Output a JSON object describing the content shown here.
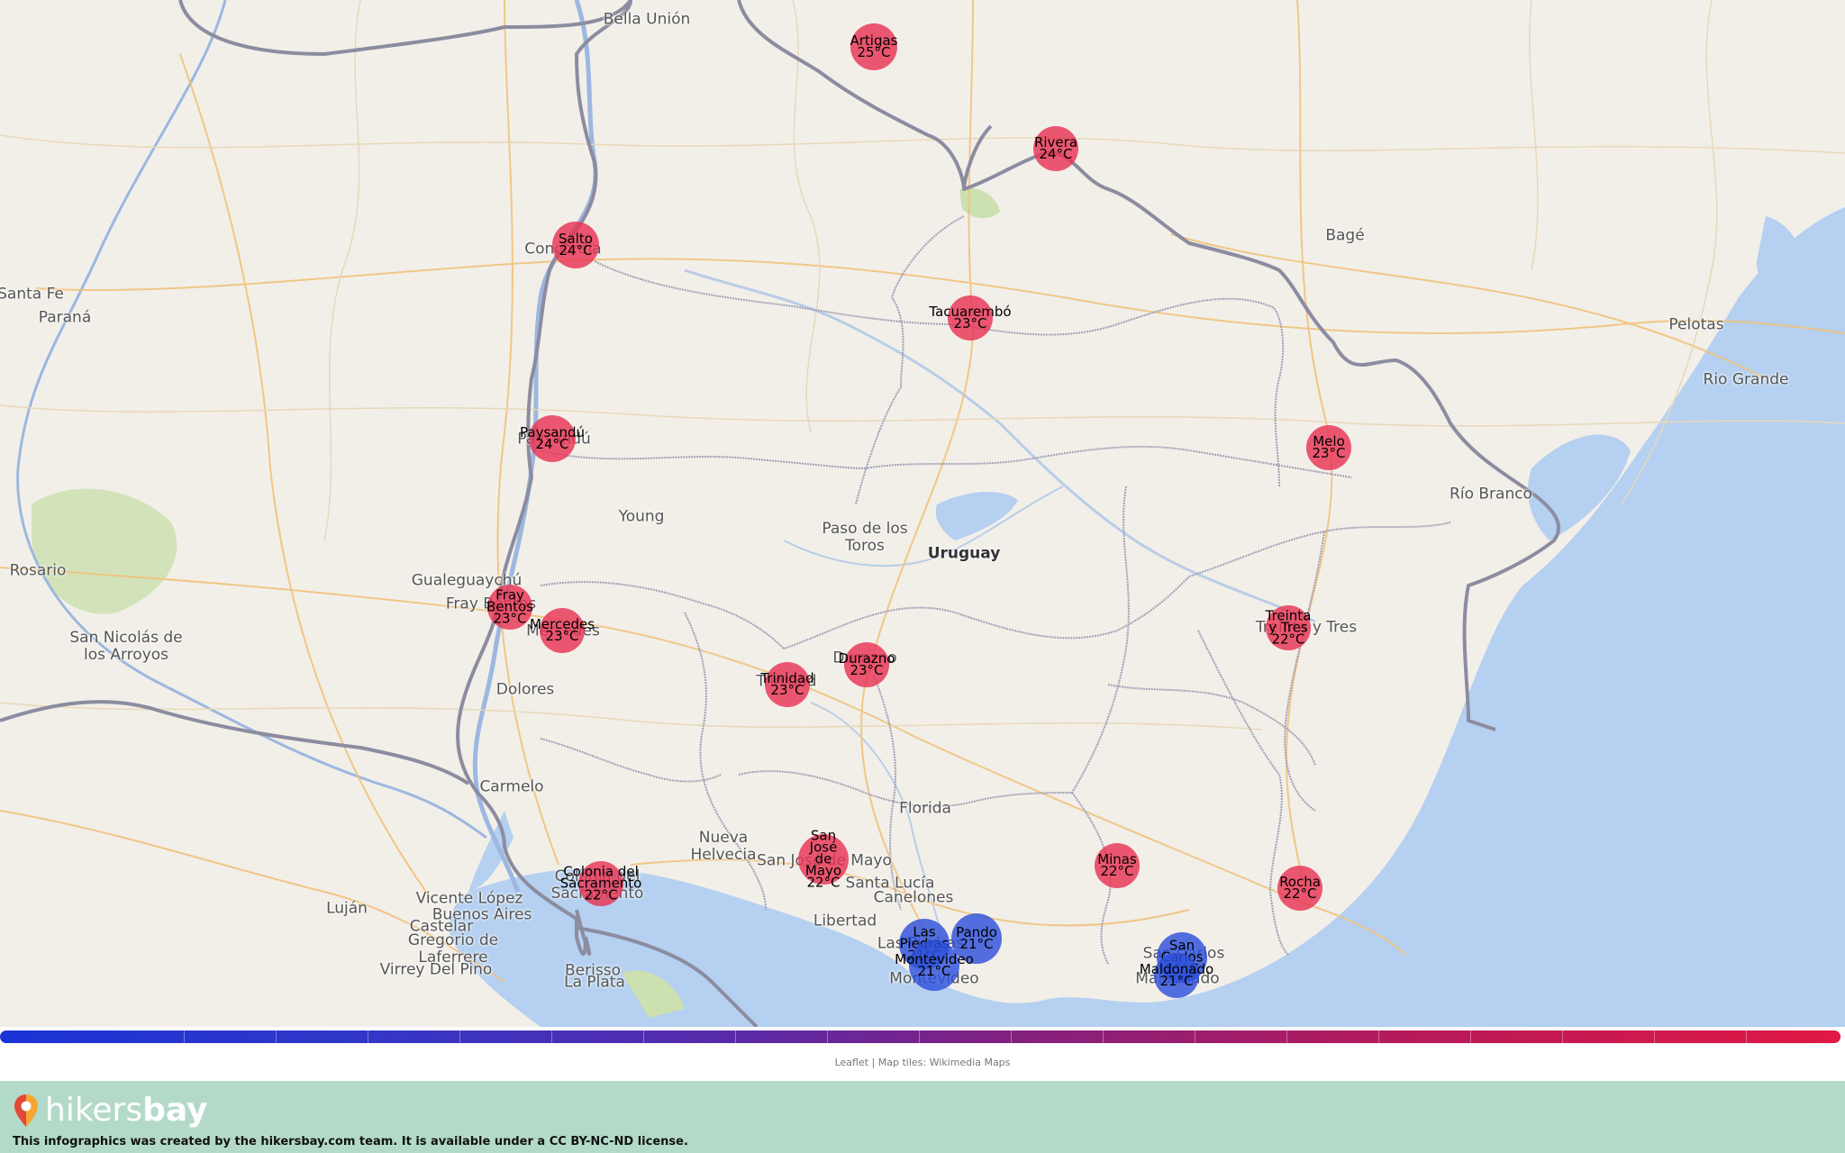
{
  "places": [
    {
      "name": "Bella Unión"
    },
    {
      "name": "Santa Fe"
    },
    {
      "name": "Paraná"
    },
    {
      "name": "Concordia"
    },
    {
      "name": "Paysandú"
    },
    {
      "name": "Young"
    },
    {
      "name": "Gualeguaychú"
    },
    {
      "name": "Fray Bentos"
    },
    {
      "name": "Mercedes"
    },
    {
      "name": "Rosario"
    },
    {
      "name": "San Nicolás de\nlos Arroyos"
    },
    {
      "name": "Dolores"
    },
    {
      "name": "Carmelo"
    },
    {
      "name": "Nueva\nHelvecia"
    },
    {
      "name": "Colonia del\nSacramento"
    },
    {
      "name": "Vicente López"
    },
    {
      "name": "Buenos Aires"
    },
    {
      "name": "Castelar"
    },
    {
      "name": "Gregorio de\nLaferrere"
    },
    {
      "name": "Virrey Del Pino"
    },
    {
      "name": "Luján"
    },
    {
      "name": "Berisso"
    },
    {
      "name": "La Plata"
    },
    {
      "name": "Paso de los\nToros"
    },
    {
      "name": "Uruguay",
      "country": true
    },
    {
      "name": "Florida"
    },
    {
      "name": "Santa Lucía"
    },
    {
      "name": "Canelones"
    },
    {
      "name": "Libertad"
    },
    {
      "name": "Las Piedras"
    },
    {
      "name": "Montevideo"
    },
    {
      "name": "San Carlos"
    },
    {
      "name": "Maldonado"
    },
    {
      "name": "Bagé"
    },
    {
      "name": "Pelotas"
    },
    {
      "name": "Rio Grande"
    },
    {
      "name": "Río Branco"
    },
    {
      "name": "Treinta y Tres"
    },
    {
      "name": "Trinidad"
    },
    {
      "name": "Durazno"
    },
    {
      "name": "San José de Mayo"
    }
  ],
  "cities": [
    {
      "name": "Artigas",
      "temp": "25°C",
      "kind": "warm"
    },
    {
      "name": "Rivera",
      "temp": "24°C",
      "kind": "warm"
    },
    {
      "name": "Salto",
      "temp": "24°C",
      "kind": "warm"
    },
    {
      "name": "Tacuarembó",
      "temp": "23°C",
      "kind": "warm"
    },
    {
      "name": "Paysandú",
      "temp": "24°C",
      "kind": "warm"
    },
    {
      "name": "Melo",
      "temp": "23°C",
      "kind": "warm"
    },
    {
      "name": "Fray\nBentos",
      "temp": "23°C",
      "kind": "warm"
    },
    {
      "name": "Mercedes",
      "temp": "23°C",
      "kind": "warm"
    },
    {
      "name": "Treinta\ny Tres",
      "temp": "22°C",
      "kind": "warm"
    },
    {
      "name": "Durazno",
      "temp": "23°C",
      "kind": "warm"
    },
    {
      "name": "Trinidad",
      "temp": "23°C",
      "kind": "warm"
    },
    {
      "name": "San\nJosé\nde\nMayo",
      "temp": "22°C",
      "kind": "warm"
    },
    {
      "name": "Colonia del\nSacramento",
      "temp": "22°C",
      "kind": "warm"
    },
    {
      "name": "Minas",
      "temp": "22°C",
      "kind": "warm"
    },
    {
      "name": "Rocha",
      "temp": "22°C",
      "kind": "warm"
    },
    {
      "name": "Las\nPiedras",
      "temp": "21°C",
      "kind": "cool"
    },
    {
      "name": "Pando",
      "temp": "21°C",
      "kind": "cool"
    },
    {
      "name": "Montevideo",
      "temp": "21°C",
      "kind": "cool"
    },
    {
      "name": "San\nCarlos",
      "temp": "21°C",
      "kind": "cool"
    },
    {
      "name": "Maldonado",
      "temp": "21°C",
      "kind": "cool"
    }
  ],
  "colors": {
    "land": "#f2efe9",
    "water": "#b5d0f0",
    "warm": "#e83454",
    "cool": "#2d50dc",
    "border": "#8c8ca0",
    "footer": "#b3dac8"
  },
  "attribution": {
    "leaflet": "Leaflet",
    "sep": " | ",
    "tiles": "Map tiles: Wikimedia Maps"
  },
  "footer": {
    "logo_light": "hikers",
    "logo_bold": "bay",
    "credit": "This infographics was created by the hikersbay.com team. It is available under a CC BY-NC-ND license."
  }
}
